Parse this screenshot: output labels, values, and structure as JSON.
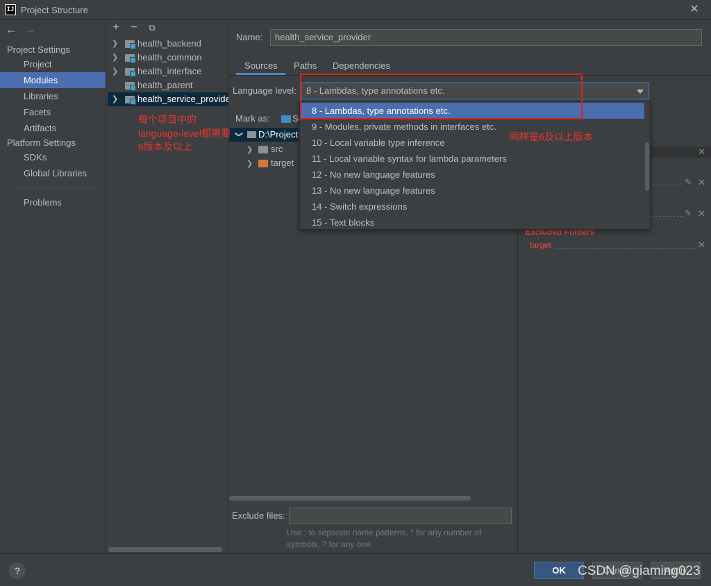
{
  "window": {
    "title": "Project Structure",
    "icon_text": "IJ"
  },
  "left_nav": {
    "back_icon": "←",
    "forward_icon": "→",
    "section_project": "Project Settings",
    "project_items": [
      "Project",
      "Modules",
      "Libraries",
      "Facets",
      "Artifacts"
    ],
    "selected": "Modules",
    "section_platform": "Platform Settings",
    "platform_items": [
      "SDKs",
      "Global Libraries"
    ],
    "problems": "Problems"
  },
  "modules": {
    "toolbar": {
      "add": "+",
      "remove": "−",
      "copy": "⧉"
    },
    "items": [
      {
        "label": "health_backend",
        "expandable": true
      },
      {
        "label": "health_common",
        "expandable": true
      },
      {
        "label": "health_interface",
        "expandable": true
      },
      {
        "label": "health_parent",
        "expandable": false
      },
      {
        "label": "health_service_provider",
        "expandable": true,
        "selected": true
      }
    ]
  },
  "form": {
    "name_label": "Name:",
    "name_value": "health_service_provider",
    "tabs": [
      "Sources",
      "Paths",
      "Dependencies"
    ],
    "active_tab": "Sources",
    "language_level_label": "Language level:",
    "language_level_value": "8 - Lambdas, type annotations etc.",
    "mark_as_label": "Mark as:",
    "mark_as_partial": "So",
    "tree": {
      "root": "D:\\Projects",
      "children": [
        {
          "label": "src",
          "color": "#87939a"
        },
        {
          "label": "target",
          "color": "#d07a3a"
        }
      ]
    },
    "exclude_files_label": "Exclude files:",
    "exclude_files_value": "",
    "exclude_help": "Use ; to separate name patterns, * for any number of symbols, ? for any one."
  },
  "dropdown": {
    "options": [
      "8 - Lambdas, type annotations etc.",
      "9 - Modules, private methods in interfaces etc.",
      "10 - Local variable type inference",
      "11 - Local variable syntax for lambda parameters",
      "12 - No new language features",
      "13 - No new language features",
      "14 - Switch expressions",
      "15 - Text blocks"
    ],
    "selected_index": 0
  },
  "content_roots": {
    "excluded_title": "Excluded Folders",
    "excluded_items": [
      "target"
    ]
  },
  "annotations": {
    "left_note": [
      "每个项目中的",
      "language-level都需要",
      "6版本及以上"
    ],
    "right_note": "同样是6及以上版本",
    "color": "#e8352f"
  },
  "buttons": {
    "help": "?",
    "ok": "OK",
    "cancel": "Cancel",
    "apply": "Apply"
  },
  "watermark": "CSDN @giaming023"
}
